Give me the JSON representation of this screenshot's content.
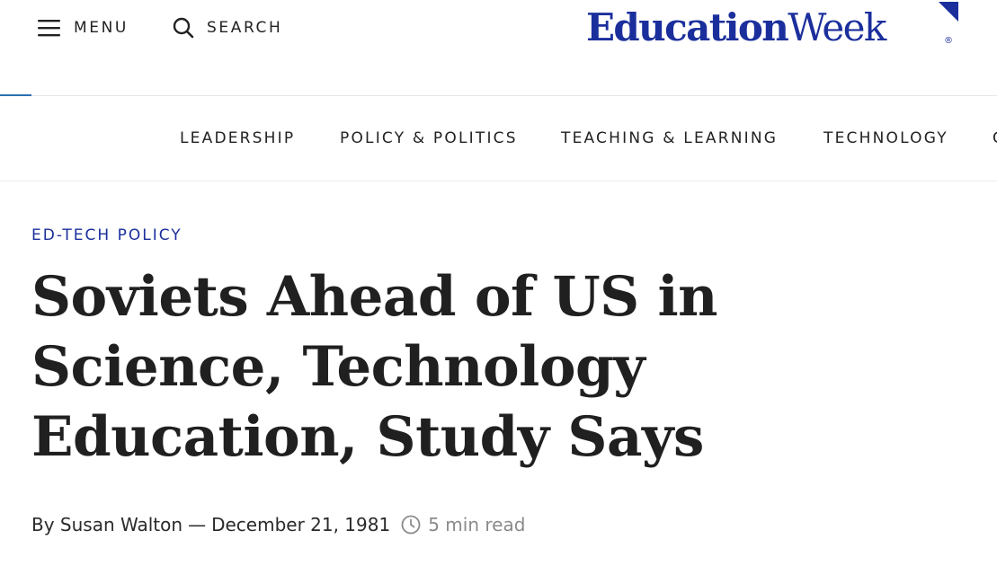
{
  "header": {
    "menu_label": "MENU",
    "search_label": "SEARCH",
    "logo": {
      "part1": "Education",
      "part2": "Week",
      "registered": "®",
      "color": "#1b2f9c"
    }
  },
  "nav": {
    "items": [
      {
        "label": "LEADERSHIP"
      },
      {
        "label": "POLICY & POLITICS"
      },
      {
        "label": "TEACHING & LEARNING"
      },
      {
        "label": "TECHNOLOGY"
      },
      {
        "label": "C"
      }
    ]
  },
  "article": {
    "kicker": "ED-TECH POLICY",
    "headline": "Soviets Ahead of US in Science, Technology Education, Study Says",
    "byline": {
      "prefix": "By",
      "author": "Susan Walton",
      "separator": "—",
      "date": "December 21, 1981",
      "read_time": "5 min read"
    }
  },
  "colors": {
    "brand": "#1b2f9c",
    "accent_line": "#2b6fb3",
    "text": "#1f1f1f",
    "muted": "#8a8a8a"
  }
}
